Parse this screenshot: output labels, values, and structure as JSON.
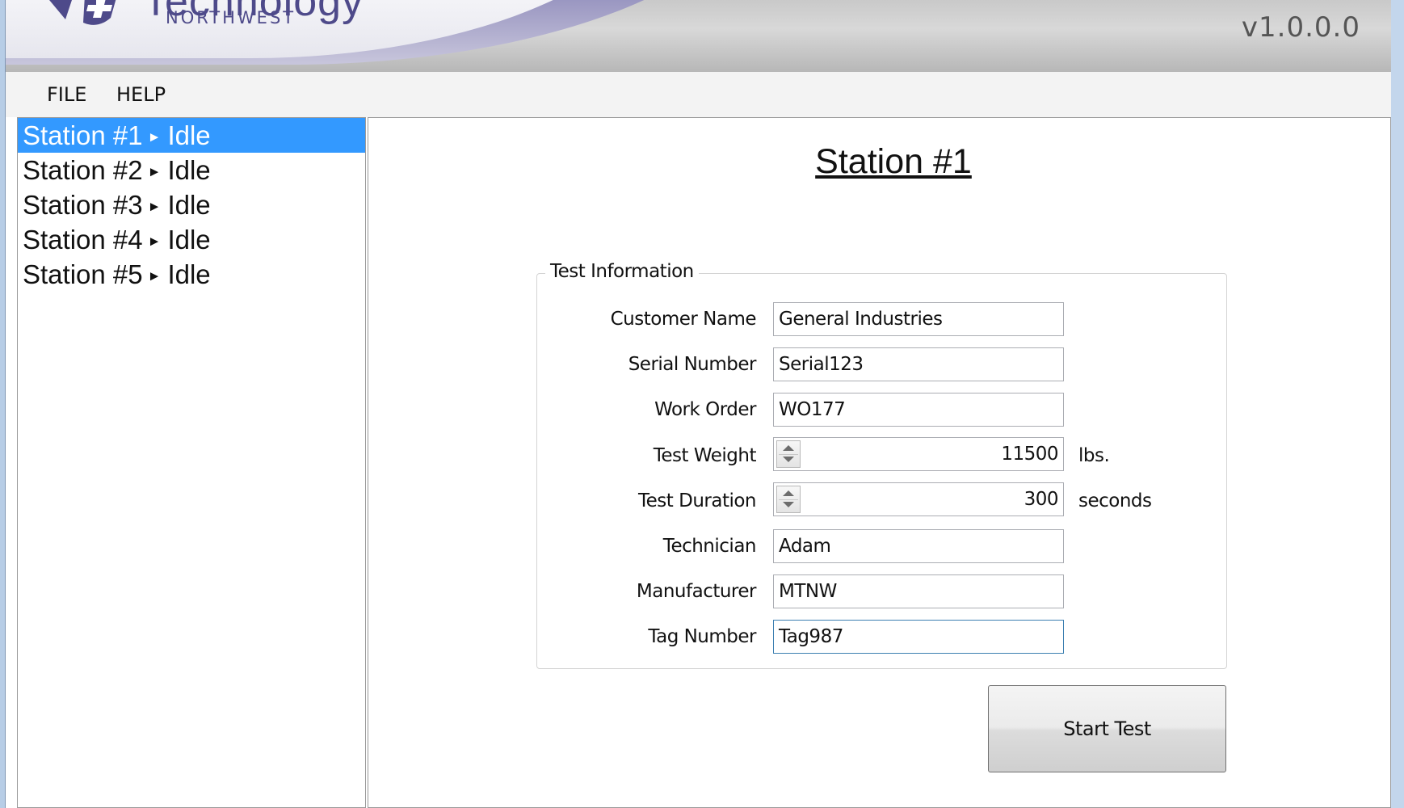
{
  "app": {
    "brand_name": "Technology",
    "brand_sub": "NORTHWEST",
    "version": "v1.0.0.0"
  },
  "menu": {
    "items": [
      {
        "label": "FILE"
      },
      {
        "label": "HELP"
      }
    ]
  },
  "stations": [
    {
      "name": "Station #1",
      "arrow": "►",
      "status": "Idle",
      "selected": true
    },
    {
      "name": "Station #2",
      "arrow": "►",
      "status": "Idle",
      "selected": false
    },
    {
      "name": "Station #3",
      "arrow": "►",
      "status": "Idle",
      "selected": false
    },
    {
      "name": "Station #4",
      "arrow": "►",
      "status": "Idle",
      "selected": false
    },
    {
      "name": "Station #5",
      "arrow": "►",
      "status": "Idle",
      "selected": false
    }
  ],
  "panel": {
    "title": "Station #1",
    "group_title": "Test Information",
    "fields": {
      "customer_name": {
        "label": "Customer Name",
        "value": "General Industries"
      },
      "serial_number": {
        "label": "Serial Number",
        "value": "Serial123"
      },
      "work_order": {
        "label": "Work Order",
        "value": "WO177"
      },
      "test_weight": {
        "label": "Test Weight",
        "value": "11500",
        "unit": "lbs."
      },
      "test_duration": {
        "label": "Test Duration",
        "value": "300",
        "unit": "seconds"
      },
      "technician": {
        "label": "Technician",
        "value": "Adam"
      },
      "manufacturer": {
        "label": "Manufacturer",
        "value": "MTNW"
      },
      "tag_number": {
        "label": "Tag Number",
        "value": "Tag987"
      }
    },
    "start_button_label": "Start Test"
  },
  "colors": {
    "selection": "#3399ff",
    "brand": "#4e4a8a",
    "focus_border": "#3c7fb1"
  }
}
